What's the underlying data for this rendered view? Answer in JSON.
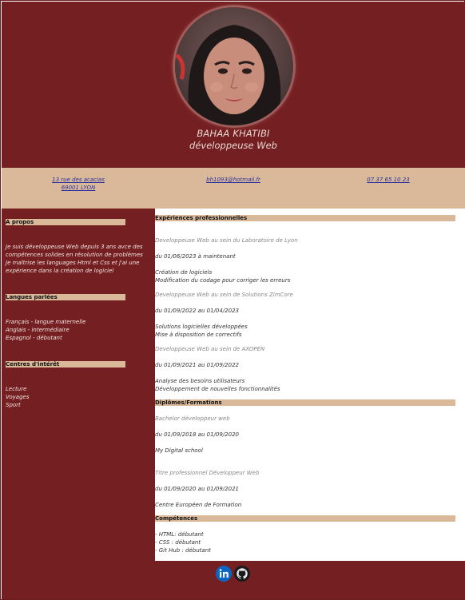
{
  "profile": {
    "name": "BAHAA KHATIBI",
    "title": "développeuse Web"
  },
  "contact": {
    "address_line1": "13 rue des acacias",
    "address_line2": "69001 LYON",
    "email": "bh1093@hotmail.fr",
    "phone": "07 37 65 10 23"
  },
  "left": {
    "about": {
      "heading": "A propos",
      "lines": [
        "Je suis développeuse Web depuis 3 ans avce des",
        "compétences solides en résolution de problèmes",
        "Je maîtrise les languages Html et Css et j'ai une",
        "expérience dans la création de logiciel"
      ]
    },
    "languages": {
      "heading": "Langues parlées",
      "items": [
        "Français - langue maternelle",
        "Anglais - intermédiaire",
        "Espagnol - débutant"
      ]
    },
    "interests": {
      "heading": "Centres d'intérêt",
      "items": [
        "Lecture",
        "Voyages",
        "Sport"
      ]
    }
  },
  "right": {
    "experience": {
      "heading": "Expériences professionnelles",
      "jobs": [
        {
          "title": "Developpeuse Web au sein du Laboratoire de Lyon",
          "dates": "du 01/06/2023 à maintenant",
          "desc1": "Création de logiciels",
          "desc2": "Modification du codage pour corriger les erreurs"
        },
        {
          "title": "Developpeuse Web au sein de Solutions ZimCore",
          "dates": "du 01/09/2022 au 01/04/2023",
          "desc1": "Solutions logicielles développées",
          "desc2": "Mise à disposition de correctifs"
        },
        {
          "title": "Developpeuse Web au sein de AXOPEN",
          "dates": "du 01/09/2021 au 01/09/2022",
          "desc1": "Analyse des besoins utilisateurs",
          "desc2": "Développement de nouvelles fonctionnalités"
        }
      ]
    },
    "education": {
      "heading": "Diplômes/Formations",
      "items": [
        {
          "title": "Bachelor développeur web",
          "dates": "du 01/09/2018 au 01/09/2020",
          "school": "My Digital school"
        },
        {
          "title": "Titre professionnel Développeur Web",
          "dates": "du 01/09/2020 au 01/09/2021",
          "school": "Centre Européen de Formation"
        }
      ]
    },
    "skills": {
      "heading": "Compétences",
      "items": [
        "- HTML: débutant",
        "- CSS : débutant",
        "- Git Hub : débutant"
      ]
    }
  },
  "footer": {
    "icons": [
      "linkedin-icon",
      "github-icon"
    ]
  },
  "colors": {
    "maroon": "#741f21",
    "tan": "#d9b99a",
    "link": "#2b2fa0"
  }
}
